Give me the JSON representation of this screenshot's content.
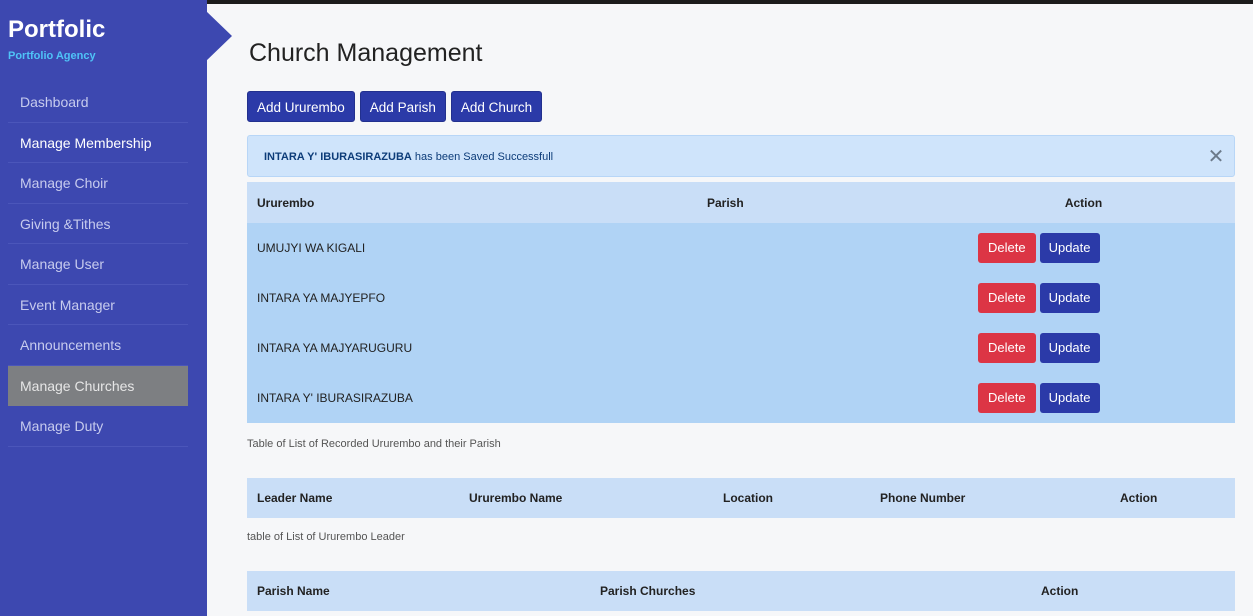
{
  "sidebar": {
    "brand_title": "Portfolic",
    "brand_subtitle": "Portfolio Agency",
    "items": [
      {
        "label": "Dashboard"
      },
      {
        "label": "Manage Membership"
      },
      {
        "label": "Manage Choir"
      },
      {
        "label": "Giving &Tithes"
      },
      {
        "label": "Manage User"
      },
      {
        "label": "Event Manager"
      },
      {
        "label": "Announcements"
      },
      {
        "label": "Manage Churches"
      },
      {
        "label": "Manage Duty"
      }
    ],
    "active_item": "Manage Churches"
  },
  "page": {
    "title": "Church Management"
  },
  "actions": {
    "add_ururembo": "Add Ururembo",
    "add_parish": "Add Parish",
    "add_church": "Add Church"
  },
  "alert": {
    "name": "INTARA Y' IBURASIRAZUBA",
    "message": "has been Saved Successfull",
    "close_glyph": "✕"
  },
  "ururembo_table": {
    "headers": [
      "Ururembo",
      "Parish",
      "Action"
    ],
    "rows": [
      {
        "ururembo": "UMUJYI WA KIGALI",
        "parish": ""
      },
      {
        "ururembo": "INTARA YA MAJYEPFO",
        "parish": ""
      },
      {
        "ururembo": "INTARA YA MAJYARUGURU",
        "parish": ""
      },
      {
        "ururembo": "INTARA Y' IBURASIRAZUBA",
        "parish": ""
      }
    ],
    "delete_label": "Delete",
    "update_label": "Update",
    "caption": "Table of List of Recorded Ururembo and their Parish"
  },
  "leader_table": {
    "headers": [
      "Leader Name",
      "Ururembo Name",
      "Location",
      "Phone Number",
      "Action"
    ],
    "caption": "table of List of Ururembo Leader"
  },
  "parish_table": {
    "headers": [
      "Parish Name",
      "Parish Churches",
      "Action"
    ]
  },
  "colors": {
    "sidebar": "#3d48b0",
    "primary_button": "#2b3aa8",
    "danger_button": "#dc3545",
    "row_highlight": "#b0d3f5",
    "header_row": "#c9def7",
    "brand_subtitle": "#4fc3f7"
  }
}
